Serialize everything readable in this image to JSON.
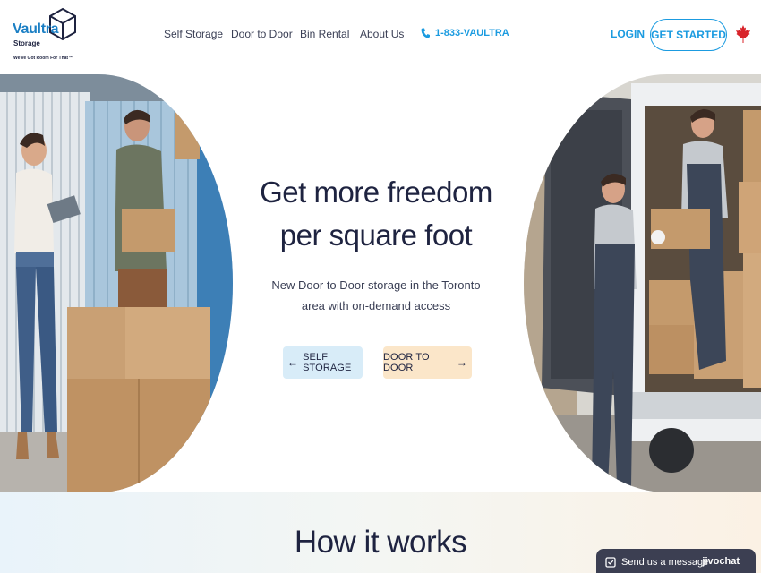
{
  "header": {
    "logo": {
      "word": "Vaultra",
      "sub": "Storage",
      "tagline": "We've Got Room For That™"
    },
    "nav": [
      {
        "label": "Self Storage"
      },
      {
        "label": "Door to Door"
      },
      {
        "label": "Bin Rental"
      },
      {
        "label": "About Us"
      }
    ],
    "phone": "1-833-VAULTRA",
    "login": "LOGIN",
    "get_started": "GET STARTED",
    "flag_icon": "canada-maple-leaf-icon"
  },
  "hero": {
    "title_line1": "Get more freedom",
    "title_line2": "per square foot",
    "subtitle_line1": "New Door to Door storage in the Toronto",
    "subtitle_line2": "area with on-demand access",
    "btn_storage": "SELF STORAGE",
    "btn_door": "DOOR TO DOOR"
  },
  "how": {
    "title": "How it works"
  },
  "chat": {
    "label": "Send us a message",
    "brand": "jivochat"
  },
  "colors": {
    "accent": "#1b9be0",
    "navy": "#1e2340",
    "btn_storage_bg": "#d8ecf8",
    "btn_door_bg": "#fbe6c9"
  }
}
